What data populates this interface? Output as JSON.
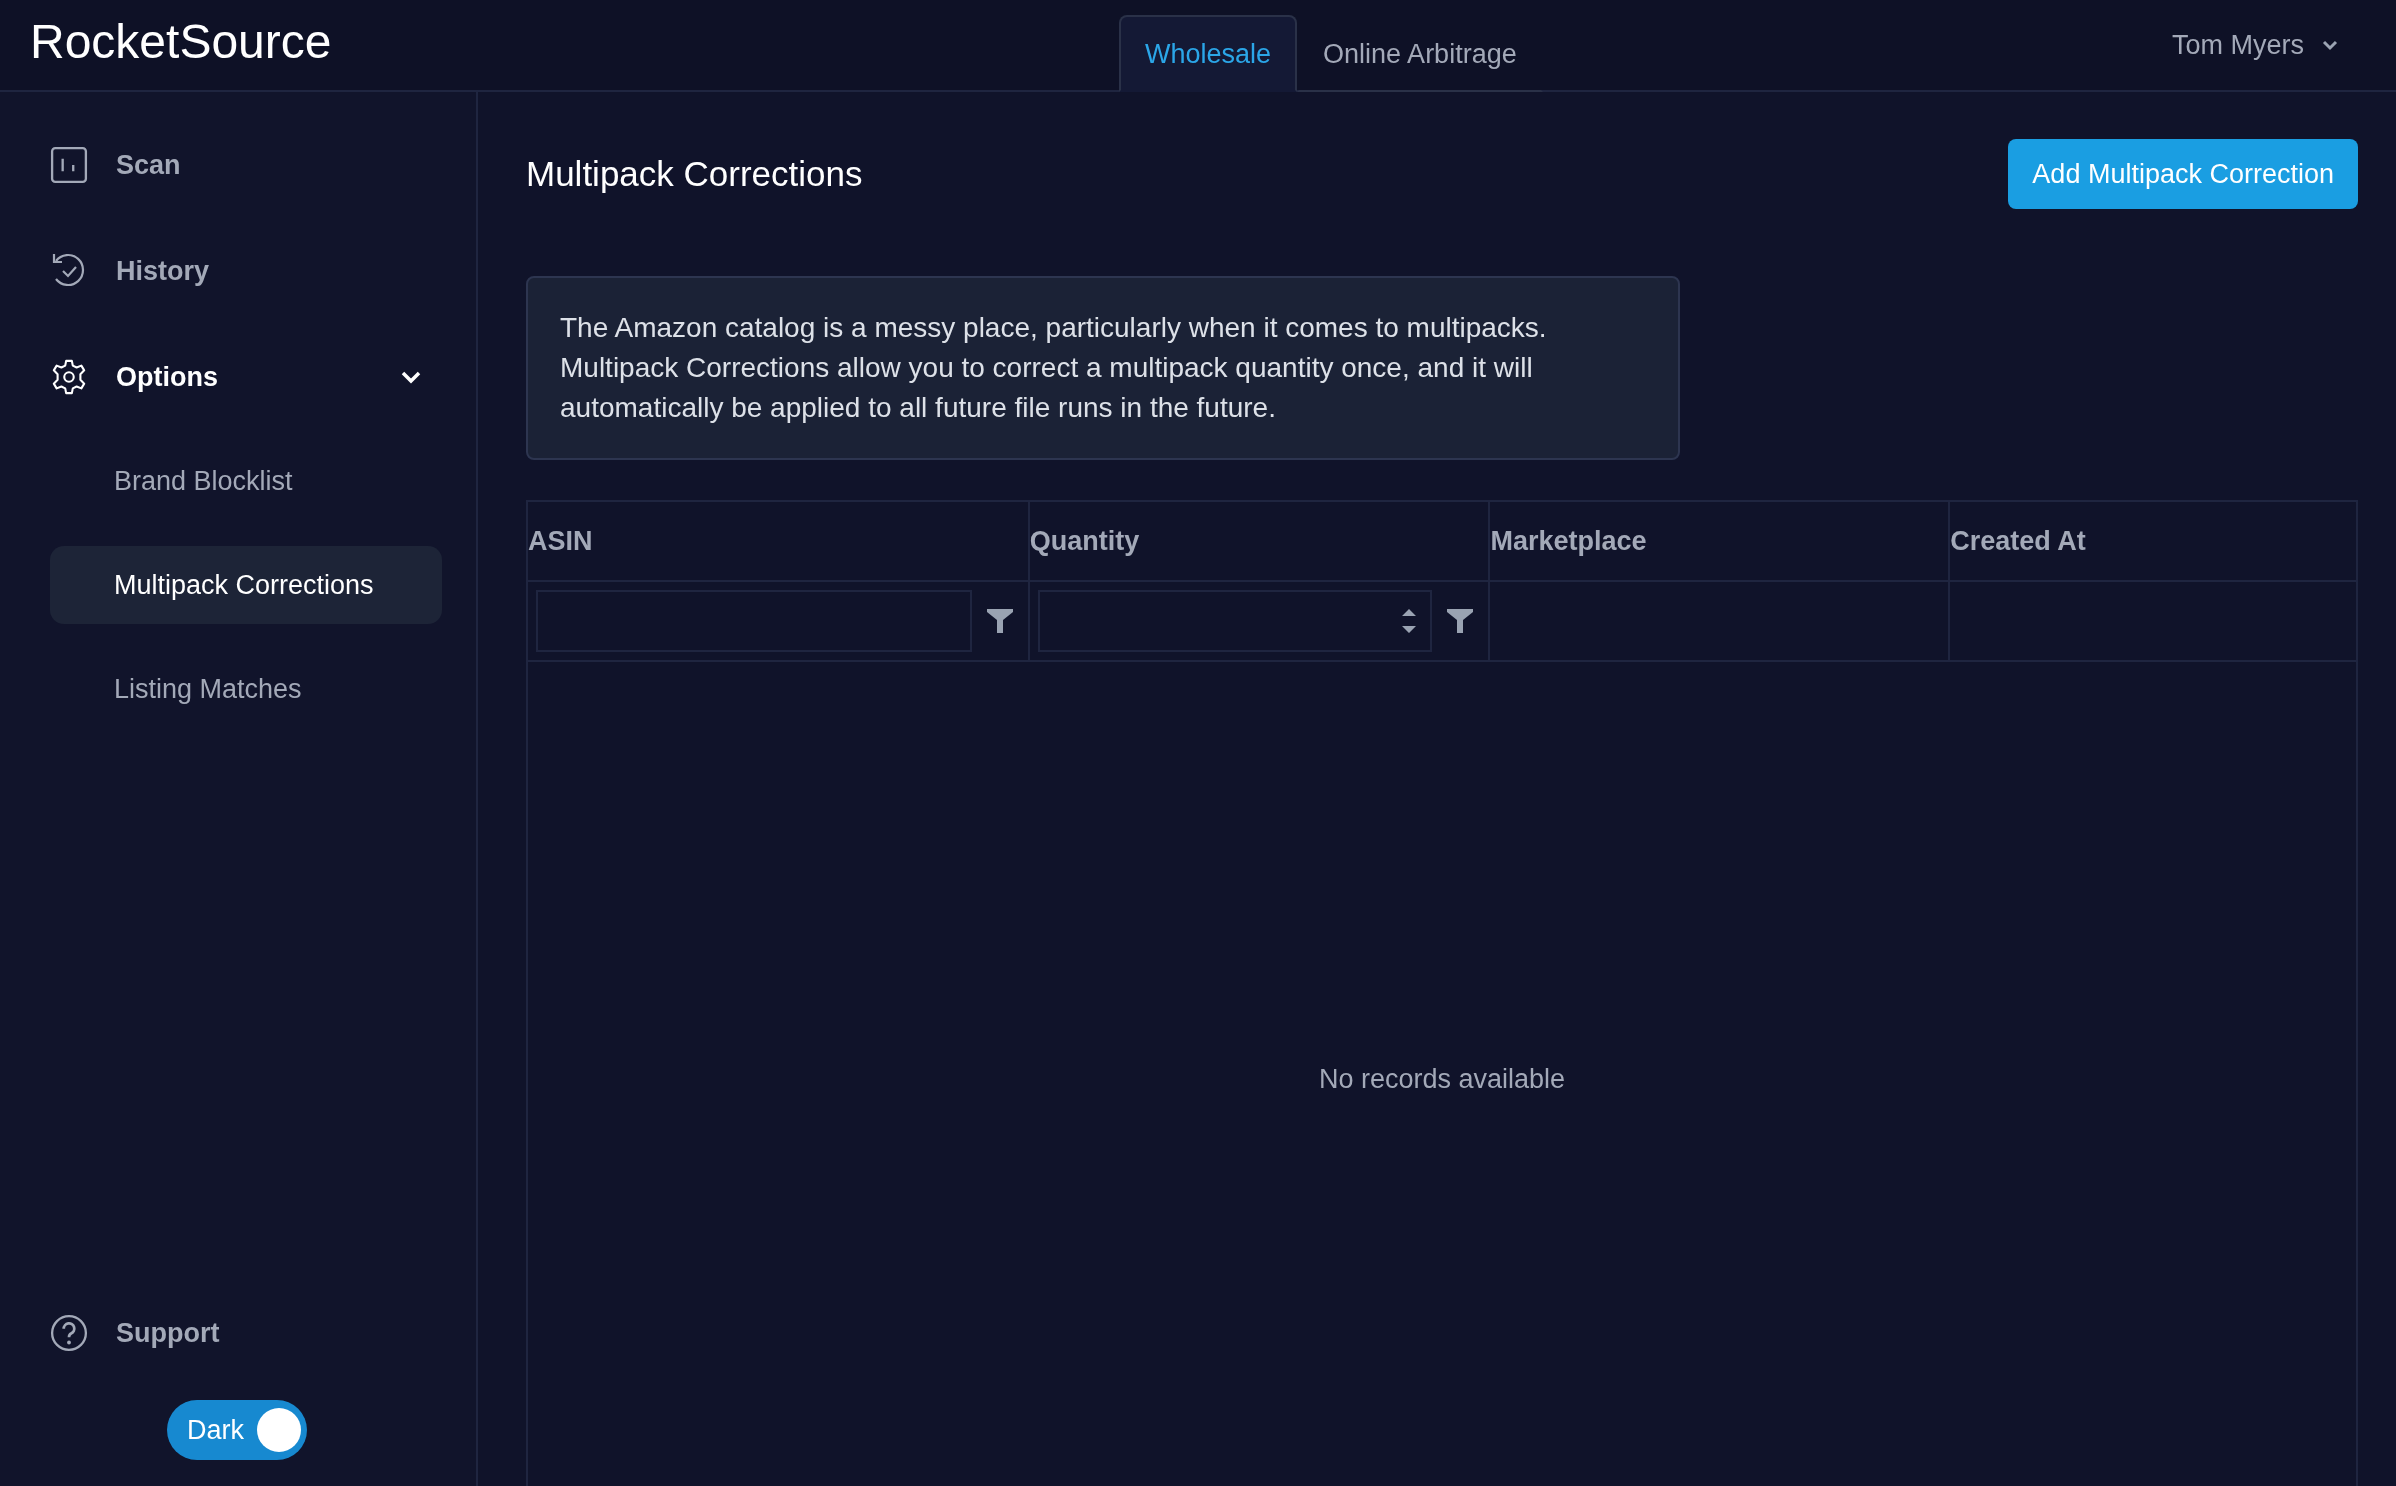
{
  "app": {
    "logo": "RocketSource"
  },
  "tabs": [
    {
      "label": "Wholesale",
      "selected": true
    },
    {
      "label": "Online Arbitrage",
      "selected": false
    }
  ],
  "user_menu": {
    "label": "Tom Myers"
  },
  "sidebar": {
    "items": [
      {
        "label": "Scan",
        "kind": "scan"
      },
      {
        "label": "History",
        "kind": "history"
      },
      {
        "label": "Options",
        "kind": "options",
        "expanded": true,
        "children": [
          {
            "label": "Brand Blocklist",
            "selected": false
          },
          {
            "label": "Multipack Corrections",
            "selected": true
          },
          {
            "label": "Listing Matches",
            "selected": false
          }
        ]
      }
    ],
    "support": {
      "label": "Support"
    },
    "theme_toggle": {
      "label": "Dark",
      "on": true
    }
  },
  "page": {
    "title": "Multipack Corrections",
    "add_button": "Add Multipack Correction",
    "info": "The Amazon catalog is a messy place, particularly when it comes to multipacks. Multipack Corrections allow you to correct a multipack quantity once, and it will automatically be applied to all future file runs in the future."
  },
  "table": {
    "columns": [
      {
        "label": "ASIN",
        "kind": "text"
      },
      {
        "label": "Quantity",
        "kind": "number"
      },
      {
        "label": "Marketplace",
        "kind": "plain"
      },
      {
        "label": "Created At",
        "kind": "plain"
      }
    ],
    "empty_message": "No records available"
  }
}
